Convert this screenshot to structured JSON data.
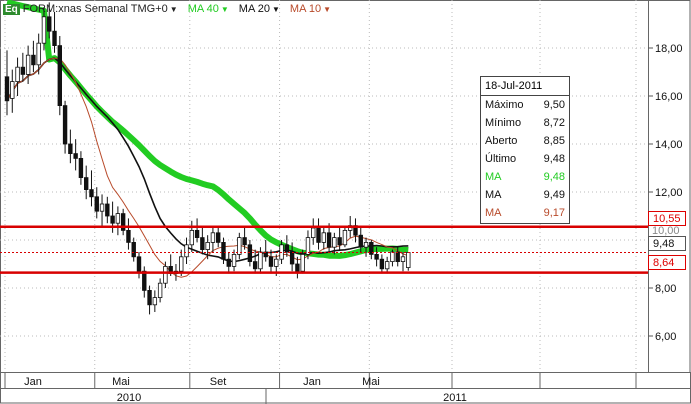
{
  "header": {
    "eq_badge": "Eq",
    "symbol": "FORM:xnas Semanal TMG+0",
    "ma40_label": "MA 40",
    "ma20_label": "MA 20",
    "ma10_label": "MA 10",
    "ma40_color": "#22cc22",
    "ma20_color": "#111111",
    "ma10_color": "#b84a2a"
  },
  "tooltip": {
    "date": "18-Jul-2011",
    "rows": [
      {
        "label": "Máximo",
        "value": "9,50",
        "color": "#111111"
      },
      {
        "label": "Mínimo",
        "value": "8,72",
        "color": "#111111"
      },
      {
        "label": "Aberto",
        "value": "8,85",
        "color": "#111111"
      },
      {
        "label": "Último",
        "value": "9,48",
        "color": "#111111"
      },
      {
        "label": "MA",
        "value": "9,48",
        "color": "#22cc22"
      },
      {
        "label": "MA",
        "value": "9,49",
        "color": "#111111"
      },
      {
        "label": "MA",
        "value": "9,17",
        "color": "#b84a2a"
      }
    ]
  },
  "price_tags": {
    "upper": "10,55",
    "last": "9,48",
    "lower": "8,64",
    "partial": "10,00"
  },
  "chart_data": {
    "type": "candlestick",
    "y_ticks": [
      "6,00",
      "8,00",
      "10,00",
      "12,00",
      "14,00",
      "16,00",
      "18,00"
    ],
    "x_month_labels": [
      "Jan",
      "Mai",
      "Set",
      "Jan",
      "Mai"
    ],
    "x_year_labels": [
      "2010",
      "2011"
    ],
    "ylim": [
      4.5,
      20
    ],
    "horizontal_lines": [
      10.55,
      8.64
    ],
    "last_price_line": 9.48,
    "candles": [
      [
        16.8,
        17.9,
        15.2,
        15.8
      ],
      [
        15.9,
        17.1,
        15.3,
        16.6
      ],
      [
        16.6,
        17.6,
        16.0,
        17.2
      ],
      [
        17.2,
        17.8,
        16.6,
        16.9
      ],
      [
        16.9,
        18.1,
        16.5,
        17.7
      ],
      [
        17.7,
        18.3,
        17.0,
        17.3
      ],
      [
        17.3,
        18.6,
        16.9,
        18.2
      ],
      [
        18.2,
        19.7,
        17.9,
        19.3
      ],
      [
        19.3,
        19.9,
        18.4,
        18.7
      ],
      [
        18.7,
        19.5,
        17.8,
        18.1
      ],
      [
        18.1,
        18.5,
        15.2,
        15.6
      ],
      [
        15.6,
        15.8,
        13.6,
        14.0
      ],
      [
        14.0,
        14.6,
        13.2,
        13.6
      ],
      [
        13.6,
        14.2,
        12.9,
        13.4
      ],
      [
        13.4,
        13.7,
        12.3,
        12.6
      ],
      [
        12.6,
        13.1,
        11.7,
        12.1
      ],
      [
        12.1,
        12.9,
        11.4,
        11.8
      ],
      [
        11.8,
        12.2,
        10.9,
        11.2
      ],
      [
        11.2,
        11.9,
        10.6,
        11.5
      ],
      [
        11.5,
        11.8,
        10.7,
        11.0
      ],
      [
        11.0,
        11.6,
        10.3,
        10.7
      ],
      [
        10.7,
        11.4,
        10.2,
        11.1
      ],
      [
        11.1,
        11.3,
        10.2,
        10.4
      ],
      [
        10.4,
        10.9,
        9.6,
        9.9
      ],
      [
        9.9,
        10.1,
        9.1,
        9.3
      ],
      [
        9.3,
        9.5,
        8.4,
        8.7
      ],
      [
        8.7,
        8.9,
        7.6,
        7.9
      ],
      [
        7.9,
        8.1,
        6.9,
        7.3
      ],
      [
        7.3,
        7.9,
        7.0,
        7.6
      ],
      [
        7.6,
        8.4,
        7.4,
        8.2
      ],
      [
        8.2,
        9.1,
        8.0,
        8.9
      ],
      [
        8.9,
        9.4,
        8.5,
        8.6
      ],
      [
        8.6,
        9.0,
        8.3,
        8.7
      ],
      [
        8.7,
        9.6,
        8.5,
        9.3
      ],
      [
        9.3,
        10.1,
        9.0,
        9.8
      ],
      [
        9.8,
        10.8,
        9.5,
        10.4
      ],
      [
        10.4,
        10.9,
        9.9,
        10.1
      ],
      [
        10.1,
        10.6,
        9.4,
        9.6
      ],
      [
        9.6,
        10.2,
        9.2,
        9.9
      ],
      [
        9.9,
        10.5,
        9.5,
        10.3
      ],
      [
        10.3,
        10.6,
        9.7,
        9.9
      ],
      [
        9.9,
        10.1,
        9.0,
        9.2
      ],
      [
        9.2,
        9.5,
        8.6,
        8.9
      ],
      [
        8.9,
        9.6,
        8.7,
        9.4
      ],
      [
        9.4,
        10.3,
        9.2,
        10.1
      ],
      [
        10.1,
        10.5,
        9.6,
        9.8
      ],
      [
        9.8,
        10.0,
        8.9,
        9.1
      ],
      [
        9.1,
        9.6,
        8.6,
        8.8
      ],
      [
        8.8,
        9.7,
        8.6,
        9.5
      ],
      [
        9.5,
        10.0,
        9.1,
        9.3
      ],
      [
        9.3,
        9.6,
        8.6,
        8.9
      ],
      [
        8.9,
        9.4,
        8.5,
        9.2
      ],
      [
        9.2,
        10.0,
        9.0,
        9.8
      ],
      [
        9.8,
        10.2,
        9.3,
        9.5
      ],
      [
        9.5,
        9.9,
        8.7,
        9.0
      ],
      [
        9.0,
        9.3,
        8.4,
        8.7
      ],
      [
        8.7,
        9.6,
        8.6,
        9.4
      ],
      [
        9.4,
        10.4,
        9.2,
        10.1
      ],
      [
        10.1,
        10.9,
        9.8,
        10.5
      ],
      [
        10.5,
        10.9,
        9.6,
        9.9
      ],
      [
        9.9,
        10.6,
        9.6,
        10.3
      ],
      [
        10.3,
        10.7,
        9.5,
        9.7
      ],
      [
        9.7,
        10.3,
        9.4,
        10.1
      ],
      [
        10.1,
        10.5,
        9.6,
        9.8
      ],
      [
        9.8,
        10.6,
        9.7,
        10.4
      ],
      [
        10.4,
        11.0,
        10.1,
        10.6
      ],
      [
        10.6,
        10.9,
        9.9,
        10.2
      ],
      [
        10.2,
        10.5,
        9.5,
        9.7
      ],
      [
        9.7,
        10.1,
        9.3,
        9.9
      ],
      [
        9.9,
        10.0,
        9.2,
        9.4
      ],
      [
        9.4,
        9.7,
        8.9,
        9.2
      ],
      [
        9.2,
        9.4,
        8.6,
        8.8
      ],
      [
        8.8,
        9.3,
        8.6,
        9.1
      ],
      [
        9.1,
        9.6,
        8.9,
        9.5
      ],
      [
        9.5,
        9.7,
        8.9,
        9.1
      ],
      [
        9.1,
        9.5,
        8.7,
        9.3
      ],
      [
        8.85,
        9.5,
        8.72,
        9.48
      ]
    ]
  }
}
